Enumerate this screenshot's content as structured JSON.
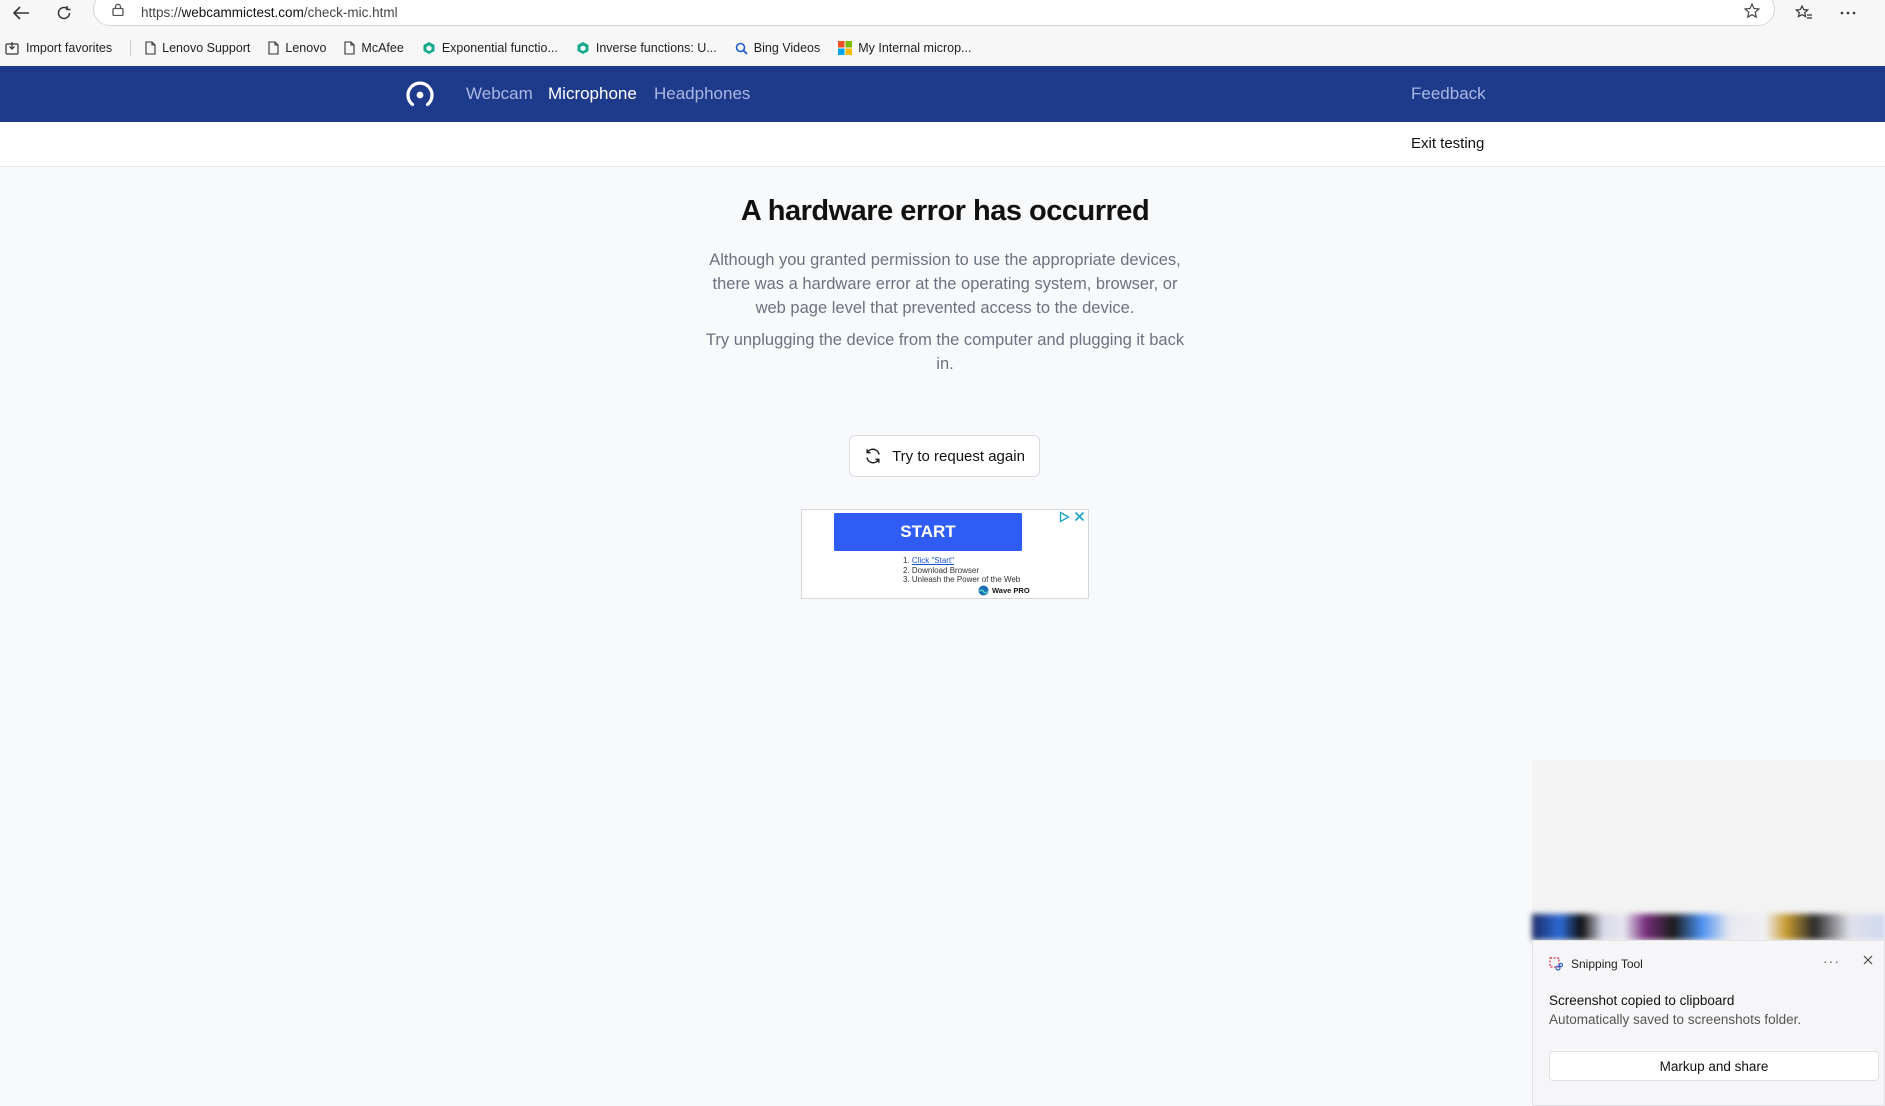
{
  "browser": {
    "url_prefix": "https://",
    "url_domain": "webcammictest.com",
    "url_path": "/check-mic.html",
    "bookmarks": [
      {
        "label": "Import favorites",
        "icon": "import-icon"
      },
      {
        "label": "Lenovo Support",
        "icon": "page-icon"
      },
      {
        "label": "Lenovo",
        "icon": "page-icon"
      },
      {
        "label": "McAfee",
        "icon": "page-icon"
      },
      {
        "label": "Exponential functio...",
        "icon": "cube-icon"
      },
      {
        "label": "Inverse functions: U...",
        "icon": "cube-icon"
      },
      {
        "label": "Bing Videos",
        "icon": "search-icon"
      },
      {
        "label": "My Internal microp...",
        "icon": "microsoft-icon"
      }
    ]
  },
  "site": {
    "nav": {
      "webcam": "Webcam",
      "microphone": "Microphone",
      "headphones": "Headphones",
      "feedback": "Feedback"
    },
    "exit": "Exit testing",
    "colors": {
      "nav_bg": "#1e3a8a",
      "nav_inactive": "#a9b8e3",
      "ad_button": "#2f5cf5"
    }
  },
  "main": {
    "title": "A hardware error has occurred",
    "paragraph1": "Although you granted permission to use the appropriate devices, there was a hardware error at the operating system, browser, or web page level that prevented access to the device.",
    "paragraph2": "Try unplugging the device from the computer and plugging it back in.",
    "retry_button": "Try to request again"
  },
  "ad": {
    "button": "START",
    "step1": "1. ",
    "step1_link": "Click \"Start\"",
    "step2": "2. Download Browser",
    "step3": "3. Unleash the Power of the Web",
    "brand": "Wave PRO"
  },
  "toast": {
    "app": "Snipping Tool",
    "more": "···",
    "title": "Screenshot copied to clipboard",
    "subtitle": "Automatically saved to screenshots folder.",
    "button": "Markup and share"
  }
}
